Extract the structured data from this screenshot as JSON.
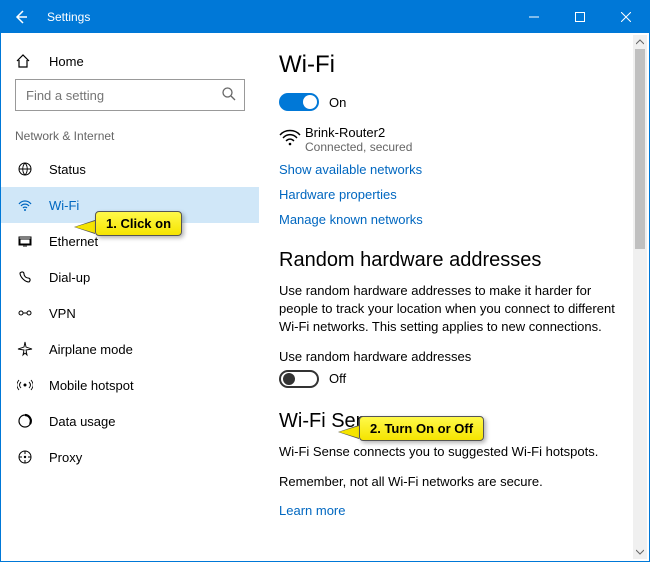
{
  "titlebar": {
    "title": "Settings"
  },
  "sidebar": {
    "home_label": "Home",
    "search_placeholder": "Find a setting",
    "group_title": "Network & Internet",
    "items": [
      {
        "label": "Status"
      },
      {
        "label": "Wi-Fi"
      },
      {
        "label": "Ethernet"
      },
      {
        "label": "Dial-up"
      },
      {
        "label": "VPN"
      },
      {
        "label": "Airplane mode"
      },
      {
        "label": "Mobile hotspot"
      },
      {
        "label": "Data usage"
      },
      {
        "label": "Proxy"
      }
    ]
  },
  "content": {
    "heading": "Wi-Fi",
    "wifi_toggle_label": "On",
    "network": {
      "name": "Brink-Router2",
      "status": "Connected, secured"
    },
    "link_show_networks": "Show available networks",
    "link_hw_props": "Hardware properties",
    "link_manage_known": "Manage known networks",
    "random_heading": "Random hardware addresses",
    "random_desc": "Use random hardware addresses to make it harder for people to track your location when you connect to different Wi-Fi networks. This setting applies to new connections.",
    "random_sublabel": "Use random hardware addresses",
    "random_toggle_label": "Off",
    "sense_heading": "Wi-Fi Sense",
    "sense_desc1": "Wi-Fi Sense connects you to suggested Wi-Fi hotspots.",
    "sense_desc2": "Remember, not all Wi-Fi networks are secure.",
    "link_learn_more": "Learn more"
  },
  "annotations": {
    "callout1": "1. Click on",
    "callout2": "2. Turn On or Off"
  }
}
